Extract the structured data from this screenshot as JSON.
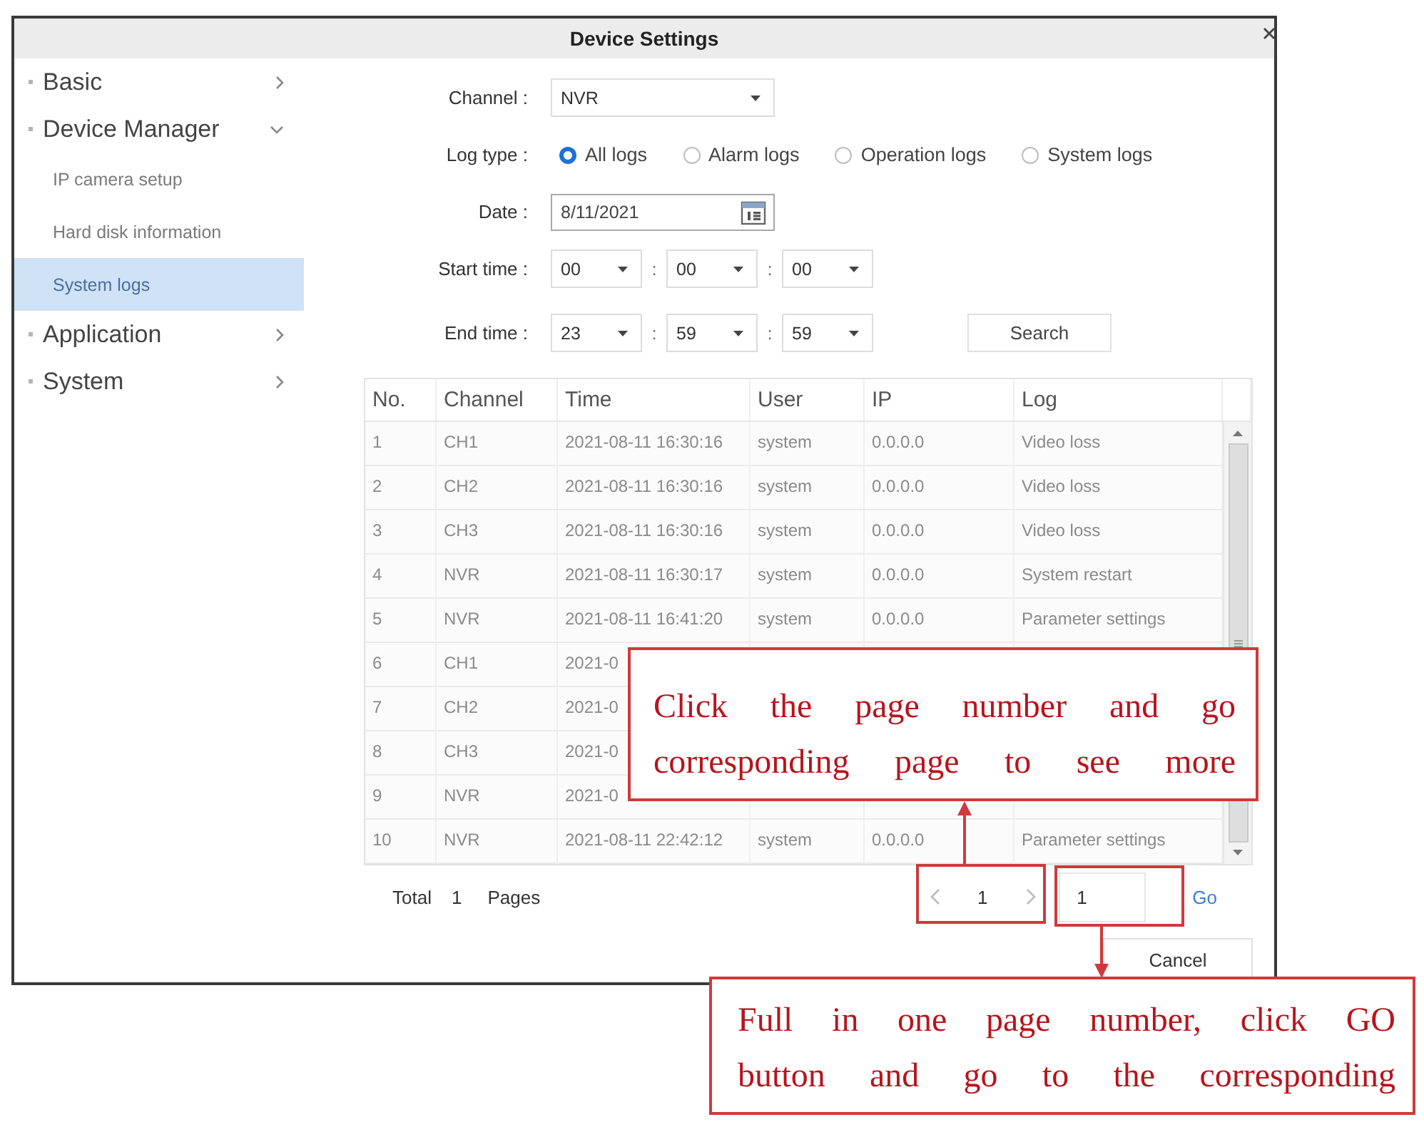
{
  "window": {
    "title": "Device Settings"
  },
  "sidebar": {
    "items": [
      {
        "label": "Basic",
        "expanded": false,
        "selected": false
      },
      {
        "label": "Device Manager",
        "expanded": true,
        "selected": false,
        "children": [
          {
            "label": "IP camera setup",
            "selected": false
          },
          {
            "label": "Hard disk information",
            "selected": false
          },
          {
            "label": "System logs",
            "selected": true
          }
        ]
      },
      {
        "label": "Application",
        "expanded": false,
        "selected": false
      },
      {
        "label": "System",
        "expanded": false,
        "selected": false
      }
    ]
  },
  "filters": {
    "channel": {
      "label": "Channel :",
      "value": "NVR"
    },
    "log_type": {
      "label": "Log type :",
      "options": [
        {
          "label": "All logs",
          "selected": true
        },
        {
          "label": "Alarm logs",
          "selected": false
        },
        {
          "label": "Operation logs",
          "selected": false
        },
        {
          "label": "System logs",
          "selected": false
        }
      ]
    },
    "date": {
      "label": "Date :",
      "value": "8/11/2021"
    },
    "start_time": {
      "label": "Start time :",
      "values": [
        "00",
        "00",
        "00"
      ],
      "separators": [
        ":",
        ":"
      ]
    },
    "end_time": {
      "label": "End time :",
      "values": [
        "23",
        "59",
        "59"
      ],
      "separators": [
        ":",
        ":"
      ]
    },
    "search_button": "Search"
  },
  "table": {
    "columns": [
      "No.",
      "Channel",
      "Time",
      "User",
      "IP",
      "Log"
    ],
    "rows": [
      [
        "1",
        "CH1",
        "2021-08-11 16:30:16",
        "system",
        "0.0.0.0",
        "Video loss"
      ],
      [
        "2",
        "CH2",
        "2021-08-11 16:30:16",
        "system",
        "0.0.0.0",
        "Video loss"
      ],
      [
        "3",
        "CH3",
        "2021-08-11 16:30:16",
        "system",
        "0.0.0.0",
        "Video loss"
      ],
      [
        "4",
        "NVR",
        "2021-08-11 16:30:17",
        "system",
        "0.0.0.0",
        "System restart"
      ],
      [
        "5",
        "NVR",
        "2021-08-11 16:41:20",
        "system",
        "0.0.0.0",
        "Parameter settings"
      ],
      [
        "6",
        "CH1",
        "2021-0"
      ],
      [
        "7",
        "CH2",
        "2021-0"
      ],
      [
        "8",
        "CH3",
        "2021-0"
      ],
      [
        "9",
        "NVR",
        "2021-0"
      ],
      [
        "10",
        "NVR",
        "2021-08-11 22:42:12",
        "system",
        "0.0.0.0",
        "Parameter settings"
      ]
    ]
  },
  "footer": {
    "total_label": "Total",
    "total_pages": "1",
    "pages_label": "Pages",
    "current_page": "1",
    "page_input": "1",
    "go_link": "Go",
    "cancel_button": "Cancel"
  },
  "annotations": [
    {
      "text": "Click the page number and go\ncorresponding page to see more"
    },
    {
      "text": "Full in one page number, click GO\nbutton and go to the corresponding"
    }
  ]
}
